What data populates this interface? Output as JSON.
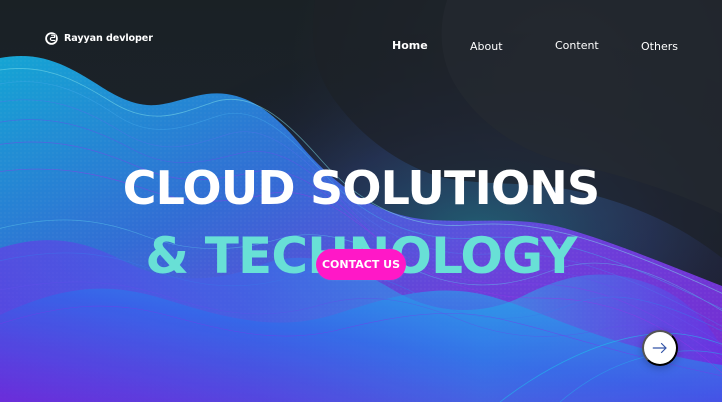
{
  "brand": {
    "name": "Rayyan devloper",
    "icon": "logo-mark-icon"
  },
  "nav": {
    "items": [
      {
        "label": "Home",
        "active": true
      },
      {
        "label": "About",
        "active": false
      },
      {
        "label": "Content",
        "active": false
      },
      {
        "label": "Others",
        "active": false
      }
    ]
  },
  "hero": {
    "headline_line_1": "CLOUD SOLUTIONS",
    "headline_line_2": "& TECHNOLOGY",
    "cta_label": "CONTACT US"
  },
  "next": {
    "icon": "arrow-right-icon"
  },
  "colors": {
    "background": "#1f252b",
    "headline_accent": "#68e0d6",
    "button": "#ff18c7",
    "wave_cyan": "#19d8ff",
    "wave_purple": "#8a35ff",
    "text": "#ffffff"
  }
}
